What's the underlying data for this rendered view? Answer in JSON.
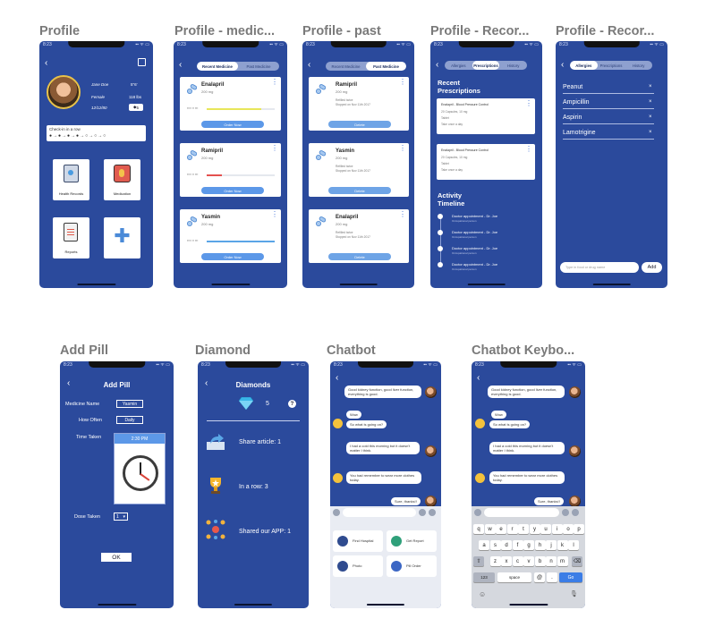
{
  "titles": {
    "profile": "Profile",
    "medicine": "Profile - medic...",
    "past": "Profile - past",
    "records": "Profile - Recor...",
    "records2": "Profile - Recor...",
    "addpill": "Add Pill",
    "diamond": "Diamond",
    "chatbot": "Chatbot",
    "chatbot_kbd": "Chatbot Keybo..."
  },
  "status": {
    "time": "8:23",
    "signal": "▪▪ ᯤ ▭"
  },
  "profile": {
    "name": "Jane Doe",
    "height": "5\"6'",
    "gender": "Female",
    "weight": "118 lbs",
    "dob": "12/12/80",
    "diamonds": "5",
    "checkin_title": "Check-in in a row",
    "tiles": [
      "Health Records",
      "Medication",
      "Reports",
      ""
    ]
  },
  "medicine": {
    "tabs": [
      "Recent Medicine",
      "Past Medicine"
    ],
    "items": [
      {
        "name": "Enalapril",
        "dose": "200 mg",
        "progress": 0.8,
        "color": "#e8e65a",
        "button": "Order Now"
      },
      {
        "name": "Ramipril",
        "dose": "200 mg",
        "progress": 0.22,
        "color": "#e4514f",
        "button": "Order Now"
      },
      {
        "name": "Yasmin",
        "dose": "200 mg",
        "progress": 1.0,
        "color": "#5ba5e6",
        "button": "Order Now"
      }
    ]
  },
  "past": {
    "tabs": [
      "Recent Medicine",
      "Past Medicine"
    ],
    "items": [
      {
        "name": "Ramipril",
        "dose": "200 mg",
        "line1": "Refilled twice",
        "line2": "Stopped on Nov 11th 2017",
        "button": "Delete"
      },
      {
        "name": "Yasmin",
        "dose": "200 mg",
        "line1": "Refilled twice",
        "line2": "Stopped on Nov 11th 2017",
        "button": "Delete"
      },
      {
        "name": "Enalapril",
        "dose": "200 mg",
        "line1": "Refilled twice",
        "line2": "Stopped on Nov 11th 2017",
        "button": "Delete"
      }
    ]
  },
  "records": {
    "tabs": [
      "Allergies",
      "Prescriptions",
      "History"
    ],
    "title": "Recent Prescriptions",
    "presc": [
      {
        "l1": "Enalapril - Blood Pressure Control",
        "l2": "20 Capsules, 10 mg",
        "l3": "Tablet",
        "l4": "Take once a day"
      },
      {
        "l1": "Enalapril - Blood Pressure Control",
        "l2": "20 Capsules, 10 mg",
        "l3": "Tablet",
        "l4": "Take once a day"
      }
    ],
    "timeline_title": "Activity Timeline",
    "timeline": [
      {
        "t": "Doctor appointment - Dr. Joe",
        "s": "Occupational person"
      },
      {
        "t": "Doctor appointment - Dr. Joe",
        "s": "Occupational person"
      },
      {
        "t": "Doctor appointment - Dr. Joe",
        "s": "Occupational person"
      },
      {
        "t": "Doctor appointment - Dr. Joe",
        "s": "Occupational person"
      }
    ]
  },
  "allergies": {
    "tabs": [
      "Allergies",
      "Prescriptions",
      "History"
    ],
    "items": [
      "Peanut",
      "Ampicillin",
      "Aspirin",
      "Lamotrigine"
    ],
    "input_placeholder": "Type in food or drug name",
    "add": "Add"
  },
  "addpill": {
    "title": "Add Pill",
    "name_label": "Medicine Name",
    "name_value": "Yasmin",
    "often_label": "How Often",
    "often_value": "Daily",
    "time_label": "Time Taken",
    "time_value": "2:30 PM",
    "dose_label": "Dose Taken",
    "dose_value": "1",
    "ok": "OK"
  },
  "diamond": {
    "title": "Diamonds",
    "count": "5",
    "help": "?",
    "items": [
      "Share article: 1",
      "In a row: 3",
      "Shared our APP: 1"
    ]
  },
  "chatbot": {
    "msgs": [
      {
        "from": "user",
        "text": "Good kidney function, good liver function, everything is good."
      },
      {
        "from": "user",
        "text": "Wow"
      },
      {
        "from": "bot",
        "text": "So what is going on?"
      },
      {
        "from": "user",
        "text": "I had a cold this morning but it doesn't matter I think."
      },
      {
        "from": "bot",
        "text": "You had remember to wear more clothes today."
      },
      {
        "from": "user",
        "text": "Sure, thanks!!"
      }
    ],
    "actions": [
      "Find Hospital",
      "Get Report",
      "Photo",
      "Pill Order"
    ]
  },
  "keyboard": {
    "row1": [
      "q",
      "w",
      "e",
      "r",
      "t",
      "y",
      "u",
      "i",
      "o",
      "p"
    ],
    "row2": [
      "a",
      "s",
      "d",
      "f",
      "g",
      "h",
      "j",
      "k",
      "l"
    ],
    "row3": [
      "z",
      "x",
      "c",
      "v",
      "b",
      "n",
      "m"
    ],
    "num": "123",
    "space": "space",
    "at": "@",
    "dot": ".",
    "go": "Go"
  },
  "colors": {
    "bg": "#2b4a9c",
    "accent": "#5c98e8"
  }
}
